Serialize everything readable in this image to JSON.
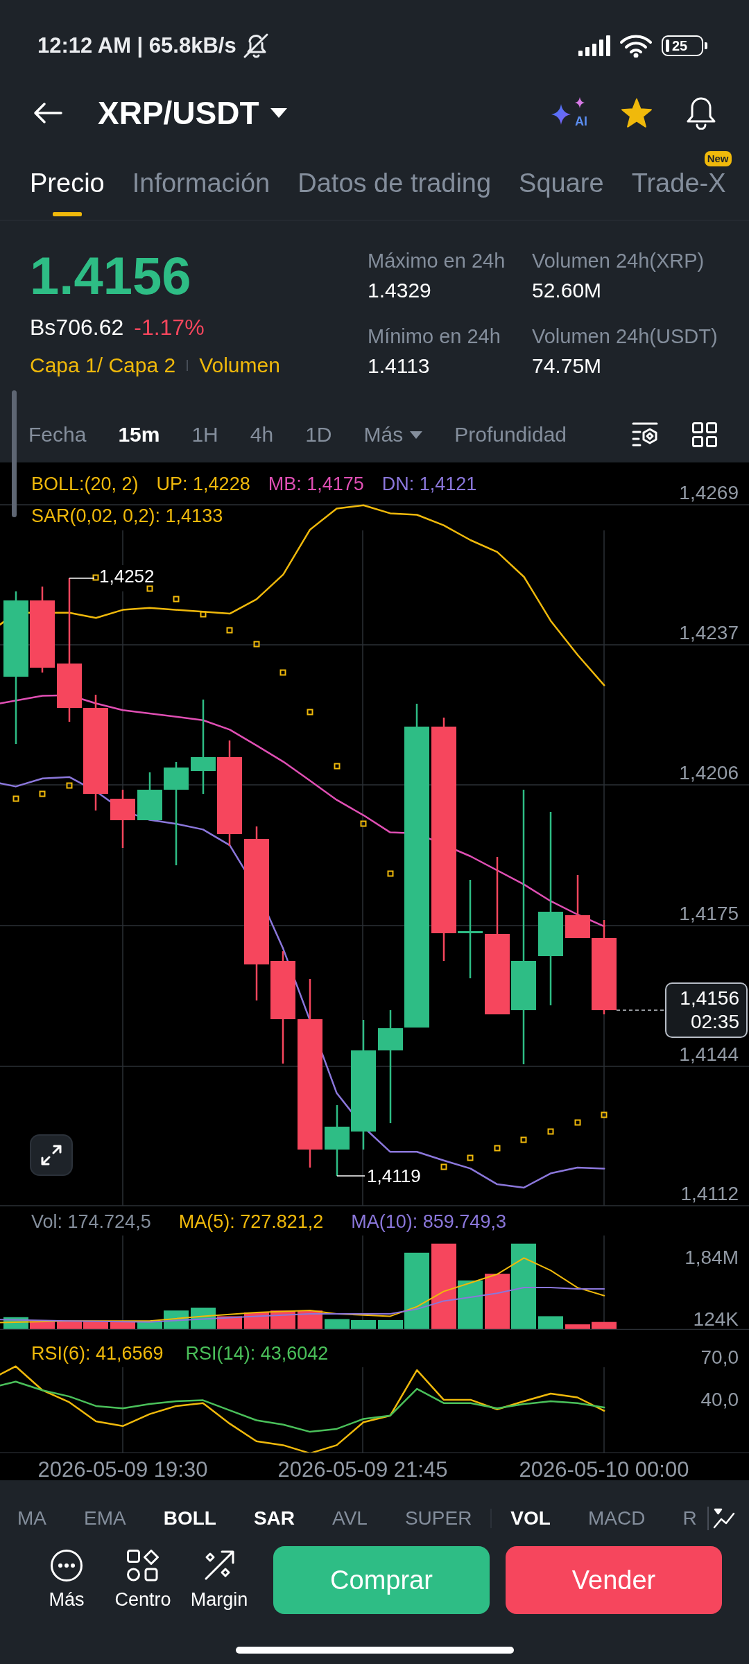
{
  "status_bar": {
    "time": "12:12 AM | 65.8kB/s",
    "battery": "25"
  },
  "header": {
    "pair": "XRP/USDT",
    "ai_label": "AI",
    "favorite": true
  },
  "tabs": [
    {
      "label": "Precio",
      "selected": true
    },
    {
      "label": "Información",
      "selected": false
    },
    {
      "label": "Datos de trading",
      "selected": false
    },
    {
      "label": "Square",
      "selected": false
    },
    {
      "label": "Trade-X",
      "selected": false,
      "badge": "New"
    }
  ],
  "ticker": {
    "last_price": "1.4156",
    "fiat_price": "Bs706.62",
    "change": "-1.17%",
    "tags": [
      "Capa 1/ Capa 2",
      "Volumen"
    ]
  },
  "stats": [
    {
      "label": "Máximo en 24h",
      "value": "1.4329"
    },
    {
      "label": "Volumen 24h(XRP)",
      "value": "52.60M"
    },
    {
      "label": "Mínimo en 24h",
      "value": "1.4113"
    },
    {
      "label": "Volumen 24h(USDT)",
      "value": "74.75M"
    }
  ],
  "intervals": [
    {
      "label": "Fecha",
      "kind": "option",
      "selected": false
    },
    {
      "label": "15m",
      "kind": "option",
      "selected": true
    },
    {
      "label": "1H",
      "kind": "option",
      "selected": false
    },
    {
      "label": "4h",
      "kind": "option",
      "selected": false
    },
    {
      "label": "1D",
      "kind": "option",
      "selected": false
    },
    {
      "label": "Más",
      "kind": "dropdown",
      "selected": false
    },
    {
      "label": "Profundidad",
      "kind": "view",
      "selected": false
    }
  ],
  "chart": {
    "legend": [
      {
        "items": [
          {
            "text": "BOLL:(20, 2)",
            "color": "#f0b90b"
          },
          {
            "text": "UP: 1,4228",
            "color": "#f0b90b"
          },
          {
            "text": "MB: 1,4175",
            "color": "#e04fb4"
          },
          {
            "text": "DN: 1,4121",
            "color": "#8b77db"
          }
        ]
      },
      {
        "items": [
          {
            "text": "SAR(0,02, 0,2): 1,4133",
            "color": "#f0b90b"
          }
        ]
      }
    ],
    "y_axis": [
      "1,4269",
      "1,4237",
      "1,4206",
      "1,4175",
      "1,4144",
      "1,4112"
    ],
    "high_label": "1,4252",
    "low_label": "1,4119",
    "price_tag": {
      "price": "1,4156",
      "countdown": "02:35"
    }
  },
  "volume": {
    "legend": [
      {
        "text": "Vol: 174.724,5",
        "color": "#848e9c"
      },
      {
        "text": "MA(5): 727.821,2",
        "color": "#f0b90b"
      },
      {
        "text": "MA(10): 859.749,3",
        "color": "#8b77db"
      }
    ],
    "y_axis": [
      "1,84M",
      "124K"
    ]
  },
  "rsi": {
    "legend": [
      {
        "text": "RSI(6): 41,6569",
        "color": "#f0b90b"
      },
      {
        "text": "RSI(14): 43,6042",
        "color": "#4ac05a"
      }
    ],
    "y_axis": [
      "70,0",
      "40,0"
    ]
  },
  "time_axis": [
    "2026-05-09 19:30",
    "2026-05-09 21:45",
    "2026-05-10 00:00"
  ],
  "indicators": {
    "main": [
      {
        "label": "MA",
        "selected": false
      },
      {
        "label": "EMA",
        "selected": false
      },
      {
        "label": "BOLL",
        "selected": true
      },
      {
        "label": "SAR",
        "selected": true
      },
      {
        "label": "AVL",
        "selected": false
      },
      {
        "label": "SUPER",
        "selected": false
      }
    ],
    "sub": [
      {
        "label": "VOL",
        "selected": true
      },
      {
        "label": "MACD",
        "selected": false
      },
      {
        "label": "R",
        "selected": false
      }
    ]
  },
  "actions": [
    {
      "label": "Más"
    },
    {
      "label": "Centro"
    },
    {
      "label": "Margin"
    }
  ],
  "trade_buttons": [
    {
      "label": "Comprar",
      "kind": "buy"
    },
    {
      "label": "Vender",
      "kind": "sell"
    }
  ]
}
